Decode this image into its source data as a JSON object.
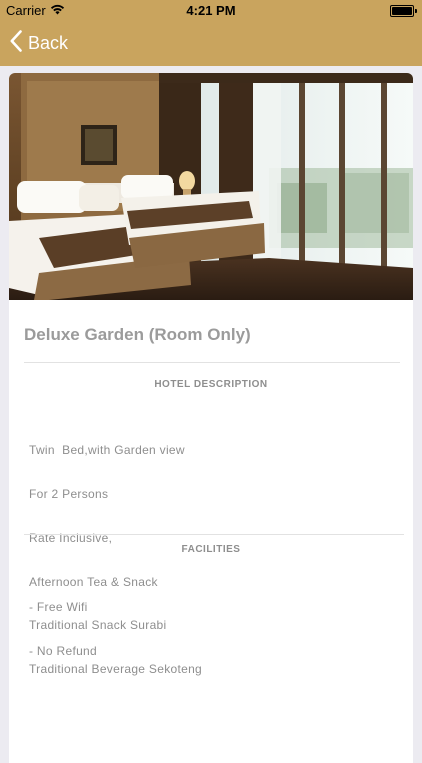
{
  "status_bar": {
    "carrier": "Carrier",
    "time": "4:21 PM"
  },
  "nav": {
    "back_label": "Back"
  },
  "room": {
    "title": "Deluxe Garden (Room Only)"
  },
  "description": {
    "header": "HOTEL DESCRIPTION",
    "lines": [
      "Twin  Bed,with Garden view",
      "For 2 Persons",
      "Rate Inclusive,",
      "Afternoon Tea & Snack",
      "Traditional Snack Surabi",
      "Traditional Beverage Sekoteng"
    ]
  },
  "facilities": {
    "header": "FACILITIES",
    "lines": [
      "- Free Wifi",
      "- No Refund"
    ]
  },
  "colors": {
    "brand": "#C9A45E",
    "page_bg": "#ECEBF1",
    "text_muted": "#8E8E8E"
  }
}
